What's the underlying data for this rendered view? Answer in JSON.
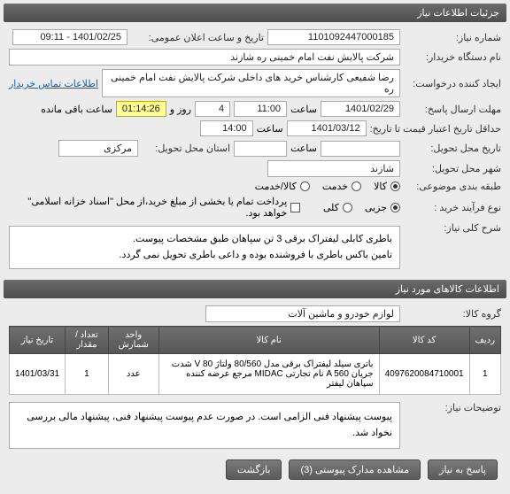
{
  "headers": {
    "details": "جزئیات اطلاعات نیاز",
    "items": "اطلاعات کالاهای مورد نیاز"
  },
  "labels": {
    "need_no": "شماره نیاز:",
    "announce_dt": "تاریخ و ساعت اعلان عمومی:",
    "buyer_org": "نام دستگاه خریدار:",
    "requester": "ایجاد کننده درخواست:",
    "buyer_contact": "اطلاعات تماس خریدار",
    "deadline": "مهلت ارسال پاسخ:",
    "remaining": "ساعت باقی مانده",
    "time_lbl": "ساعت",
    "day_and": "روز و",
    "quote_deadline": "حداقل تاریخ اعتبار قیمت تا تاریخ:",
    "delivery_date": "تاریخ محل تحویل:",
    "delivery_state": "استان محل تحویل:",
    "delivery_city": "شهر محل تحویل:",
    "category": "طبقه بندی موضوعی:",
    "purchase_type": "نوع فرآیند خرید :",
    "desc_title": "شرح کلی نیاز:",
    "group": "گروه کالا:",
    "notes": "توضیحات نیاز:"
  },
  "fields": {
    "need_no": "1101092447000185",
    "announce_dt": "1401/02/25 - 09:11",
    "buyer_org": "شرکت پالایش نفت امام خمینی  ره  شازند",
    "requester": "رضا  شفیعی  کارشناس خرید های داخلی  شرکت پالایش نفت امام خمینی  ره",
    "deadline_date": "1401/02/29",
    "deadline_time": "11:00",
    "remaining_days": "4",
    "remaining_clock": "01:14:26",
    "quote_date": "1401/03/12",
    "quote_time": "14:00",
    "delivery_state": "مرکزی",
    "delivery_city": "شازند",
    "group": "لوازم خودرو و ماشین آلات"
  },
  "radios": {
    "category": {
      "options": [
        "کالا",
        "خدمت",
        "کالا/خدمت"
      ],
      "selected": 0
    },
    "purchase_type": {
      "options": [
        "جزیی",
        "کلی"
      ],
      "selected": 0
    }
  },
  "checkbox": {
    "treasury_label": "پرداخت تمام یا بخشی از مبلغ خرید،از محل \"اسناد خزانه اسلامی\" خواهد بود.",
    "checked": false
  },
  "desc": "باطری کابلی لیفتراک برقی 3 تن سپاهان طبق مشخصات پیوست.\nتامین باکس باطری با فروشنده بوده و داعی باطری تحویل نمی گردد.",
  "table": {
    "cols": [
      "ردیف",
      "کد کالا",
      "نام کالا",
      "واحد شمارش",
      "تعداد / مقدار",
      "تاریخ نیاز"
    ],
    "rows": [
      {
        "idx": "1",
        "code": "4097620084710001",
        "name": "باتری سیلد لیفتراک برقی مدل 80/560 ولتاژ V 80 شدت جریان A 560 نام تجارتی MIDAC مرجع عرضه کننده سپاهان لیفتر",
        "unit": "عدد",
        "qty": "1",
        "date": "1401/03/31"
      }
    ]
  },
  "notes": "پیوست پیشنهاد فنی الزامی است. در صورت عدم پیوست پیشنهاد فنی، پیشنهاد مالی بررسی نخواد شد.",
  "buttons": {
    "reply": "پاسخ به نیاز",
    "attachments": "مشاهده مدارک پیوستی (3)",
    "back": "بازگشت"
  }
}
